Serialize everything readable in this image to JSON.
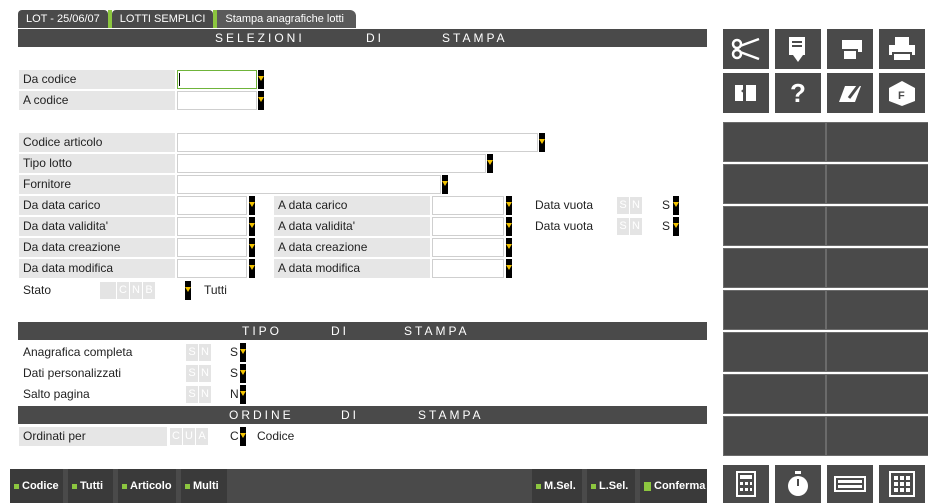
{
  "tabs": [
    "LOT - 25/06/07",
    "LOTTI SEMPLICI",
    "Stampa anagrafiche lotti"
  ],
  "sections": {
    "selezioni": [
      "SELEZIONI",
      "DI",
      "STAMPA"
    ],
    "tipo": [
      "TIPO",
      "DI",
      "STAMPA"
    ],
    "ordine": [
      "ORDINE",
      "DI",
      "STAMPA"
    ]
  },
  "fields": {
    "da_codice": "Da codice",
    "a_codice": "A codice",
    "codice_articolo": "Codice articolo",
    "tipo_lotto": "Tipo lotto",
    "fornitore": "Fornitore",
    "da_data_carico": "Da data carico",
    "a_data_carico": "A data carico",
    "data_vuota_1": "Data vuota",
    "da_data_validita": "Da data validita'",
    "a_data_validita": "A data validita'",
    "data_vuota_2": "Data vuota",
    "da_data_creazione": "Da data creazione",
    "a_data_creazione": "A data creazione",
    "da_data_modifica": "Da data modifica",
    "a_data_modifica": "A data modifica",
    "stato": "Stato",
    "stato_value": "Tutti",
    "anagrafica_completa": "Anagrafica completa",
    "dati_personalizzati": "Dati personalizzati",
    "salto_pagina": "Salto pagina",
    "ordinati_per": "Ordinati per",
    "ordinati_value": "Codice"
  },
  "values": {
    "data_vuota_1": "S",
    "data_vuota_2": "S",
    "anagrafica_completa": "S",
    "dati_personalizzati": "S",
    "salto_pagina": "N",
    "ordinati_per": "C"
  },
  "options": {
    "sn": [
      "S",
      "N"
    ],
    "stato": [
      "",
      "C",
      "N",
      "B"
    ],
    "ordine": [
      "C",
      "U",
      "A"
    ]
  },
  "buttons": {
    "codice": "Codice",
    "tutti": "Tutti",
    "articolo": "Articolo",
    "multi": "Multi",
    "msel": "M.Sel.",
    "lsel": "L.Sel.",
    "conferma": "Conferma"
  },
  "toolbar_icons": [
    "scissors-icon",
    "document-export-icon",
    "print-preview-icon",
    "printer-icon",
    "import-icon",
    "help-icon",
    "edit-icon",
    "fax-icon"
  ],
  "bottom_icons": [
    "calculator-icon",
    "timer-icon",
    "keyboard-icon",
    "grid-icon"
  ],
  "colors": {
    "accent": "#8cc63f",
    "bar": "#4a4a4a",
    "dropdown_arrow": "#f2c200"
  }
}
